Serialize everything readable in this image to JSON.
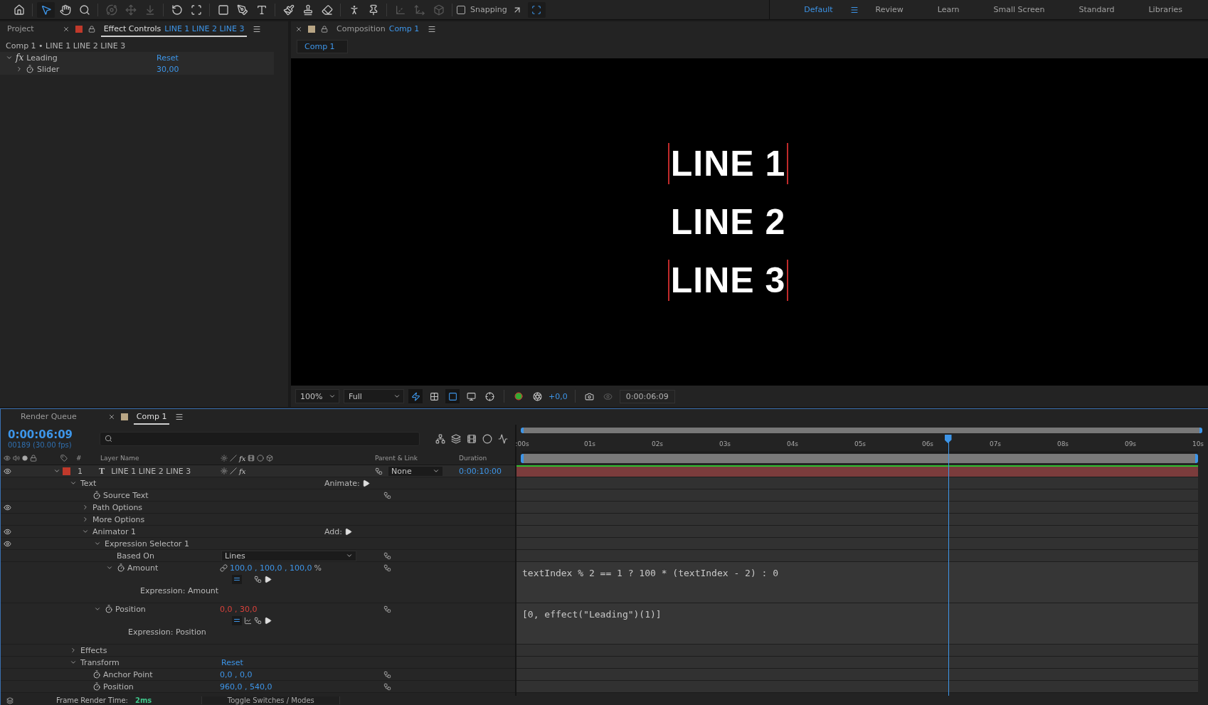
{
  "toolbar": {
    "tools": [
      {
        "kind": "home",
        "selected": false,
        "disabled": false
      },
      {
        "kind": "selection",
        "selected": true,
        "disabled": false
      },
      {
        "kind": "hand",
        "selected": false,
        "disabled": false
      },
      {
        "kind": "zoom",
        "selected": false,
        "disabled": false
      },
      {
        "kind": "orbit",
        "selected": false,
        "disabled": true
      },
      {
        "kind": "pan",
        "selected": false,
        "disabled": true
      },
      {
        "kind": "dolly",
        "selected": false,
        "disabled": true
      },
      {
        "kind": "rotate",
        "selected": false,
        "disabled": false
      },
      {
        "kind": "anchor",
        "selected": false,
        "disabled": false
      },
      {
        "kind": "rectangle",
        "selected": false,
        "disabled": false
      },
      {
        "kind": "pen",
        "selected": false,
        "disabled": false
      },
      {
        "kind": "type",
        "selected": false,
        "disabled": false
      },
      {
        "kind": "brush",
        "selected": false,
        "disabled": false
      },
      {
        "kind": "stamp",
        "selected": false,
        "disabled": false
      },
      {
        "kind": "eraser",
        "selected": false,
        "disabled": false
      },
      {
        "kind": "roto",
        "selected": false,
        "disabled": false
      },
      {
        "kind": "puppet",
        "selected": false,
        "disabled": false
      },
      {
        "kind": "localaxis",
        "selected": false,
        "disabled": true
      },
      {
        "kind": "worldaxis",
        "selected": false,
        "disabled": true
      },
      {
        "kind": "viewaxis",
        "selected": false,
        "disabled": true
      }
    ],
    "snapping": {
      "label": "Snapping",
      "checked": false
    },
    "workspaces": [
      {
        "label": "Default",
        "selected": true
      },
      {
        "label": "Review",
        "selected": false
      },
      {
        "label": "Learn",
        "selected": false
      },
      {
        "label": "Small Screen",
        "selected": false
      },
      {
        "label": "Standard",
        "selected": false
      },
      {
        "label": "Libraries",
        "selected": false
      }
    ]
  },
  "effect_controls": {
    "tabs": [
      {
        "label": "Project",
        "selected": false
      },
      {
        "label": "Effect Controls",
        "selected": true
      }
    ],
    "tab_layer": "LINE 1 LINE 2 LINE 3",
    "breadcrumb": "Comp 1 • LINE 1 LINE 2 LINE 3",
    "effect": {
      "icon": "fx",
      "name": "Leading",
      "reset": "Reset",
      "expanded": true
    },
    "property": {
      "name": "Slider",
      "value": "30,00",
      "expanded": false
    }
  },
  "composition": {
    "tab_label": "Composition",
    "tab_comp": "Comp 1",
    "comp_button": "Comp 1",
    "viewer_lines": [
      {
        "text": "LINE 1",
        "bracketed": true
      },
      {
        "text": "LINE 2",
        "bracketed": false
      },
      {
        "text": "LINE 3",
        "bracketed": true
      }
    ],
    "zoom": "100%",
    "resolution": "Full",
    "viewer_toggles": [
      {
        "kind": "fastpreview",
        "on": true
      },
      {
        "kind": "transparency",
        "on": false
      },
      {
        "kind": "masks",
        "on": true
      },
      {
        "kind": "safe",
        "on": false
      },
      {
        "kind": "region",
        "on": false
      }
    ],
    "exposure": "+0,0",
    "timecode": "0:00:06:09"
  },
  "timeline": {
    "tabs": [
      {
        "label": "Render Queue",
        "selected": false
      },
      {
        "label": "Comp 1",
        "selected": true
      }
    ],
    "timecode": "0:00:06:09",
    "frame_info": "00189 (30.00 fps)",
    "columns": {
      "number": "#",
      "layer_name": "Layer Name",
      "fx": "fx",
      "parent": "Parent & Link",
      "duration": "Duration"
    },
    "ruler": [
      ":00s",
      "01s",
      "02s",
      "03s",
      "04s",
      "05s",
      "06s",
      "07s",
      "08s",
      "09s",
      "10s"
    ],
    "playhead": {
      "level": 0.63
    },
    "layer": {
      "number": "1",
      "type_icon": "T",
      "name": "LINE 1 LINE 2 LINE 3",
      "fx": "fx",
      "expanded": true,
      "eye": true,
      "parent": "None",
      "duration": "0:00:10:00",
      "children": [
        {
          "kind": "group",
          "name": "Text",
          "expanded": true,
          "eye": false,
          "action": "Animate:",
          "children": [
            {
              "kind": "property",
              "name": "Source Text",
              "eye": false
            },
            {
              "kind": "group",
              "name": "Path Options",
              "expanded": false,
              "eye": true
            },
            {
              "kind": "group",
              "name": "More Options",
              "expanded": false,
              "eye": false
            },
            {
              "kind": "group",
              "name": "Animator 1",
              "expanded": true,
              "eye": true,
              "action": "Add:",
              "children": [
                {
                  "kind": "group",
                  "name": "Expression Selector 1",
                  "expanded": true,
                  "eye": true,
                  "children": [
                    {
                      "kind": "dropdown",
                      "name": "Based On",
                      "value": "Lines",
                      "eye": false
                    },
                    {
                      "kind": "property",
                      "name": "Amount",
                      "eye": false,
                      "expanded": true,
                      "linked": true,
                      "values": [
                        "100,0 , 100,0 , 100,0"
                      ],
                      "unit": "%",
                      "color": "#3d95e8",
                      "expression": {
                        "label": "Expression: Amount",
                        "code": "textIndex % 2 == 1 ? 100 * (textIndex - 2) : 0",
                        "graph": false
                      }
                    }
                  ]
                },
                {
                  "kind": "property",
                  "name": "Position",
                  "eye": false,
                  "expanded": true,
                  "linked": false,
                  "values": [
                    "0,0 , 30,0"
                  ],
                  "color": "#d9403a",
                  "expression": {
                    "label": "Expression: Position",
                    "code": "[0, effect(\"Leading\")(1)]",
                    "graph": true
                  }
                }
              ]
            }
          ]
        },
        {
          "kind": "group",
          "name": "Effects",
          "expanded": false,
          "eye": false
        },
        {
          "kind": "group",
          "name": "Transform",
          "expanded": true,
          "eye": false,
          "reset": "Reset",
          "children": [
            {
              "kind": "property",
              "name": "Anchor Point",
              "eye": false,
              "linked": false,
              "values": [
                "0,0 , 0,0"
              ],
              "color": "#3d95e8"
            },
            {
              "kind": "property",
              "name": "Position",
              "eye": false,
              "linked": false,
              "values": [
                "960,0 , 540,0"
              ],
              "color": "#3d95e8"
            }
          ]
        }
      ]
    },
    "status": {
      "label": "Frame Render Time:",
      "value": "2ms",
      "toggle": "Toggle Switches / Modes"
    }
  }
}
